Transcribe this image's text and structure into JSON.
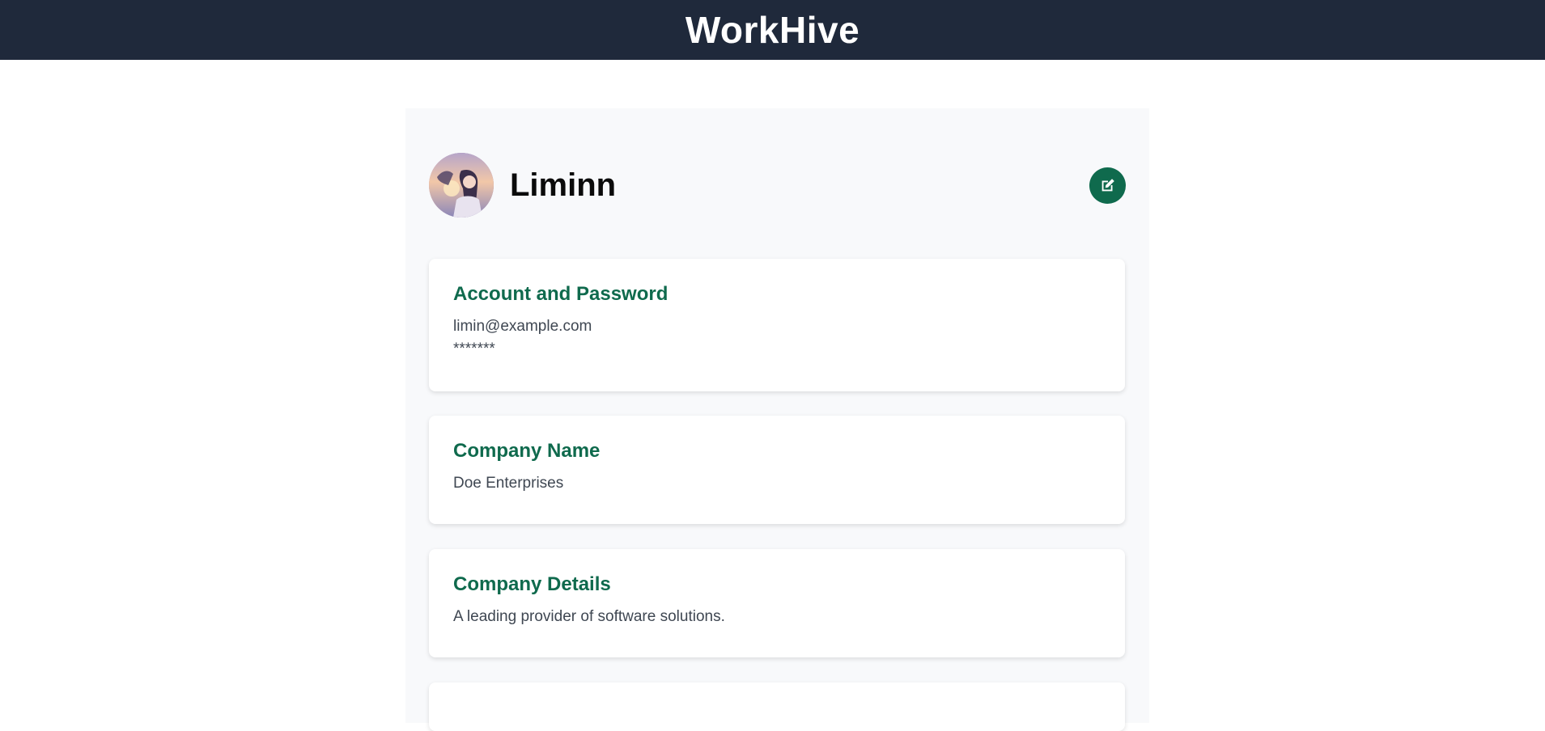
{
  "header": {
    "brand": "WorkHive"
  },
  "profile": {
    "name": "Liminn",
    "avatar_icon": "user-avatar",
    "edit_icon": "edit-icon"
  },
  "sections": {
    "account": {
      "title": "Account and Password",
      "email": "limin@example.com",
      "password": "*******"
    },
    "company_name": {
      "title": "Company Name",
      "value": "Doe Enterprises"
    },
    "company_details": {
      "title": "Company Details",
      "value": "A leading provider of software solutions."
    }
  },
  "colors": {
    "header_bg": "#1f293b",
    "accent": "#0f6a4d",
    "panel_bg": "#f8f9fb"
  }
}
